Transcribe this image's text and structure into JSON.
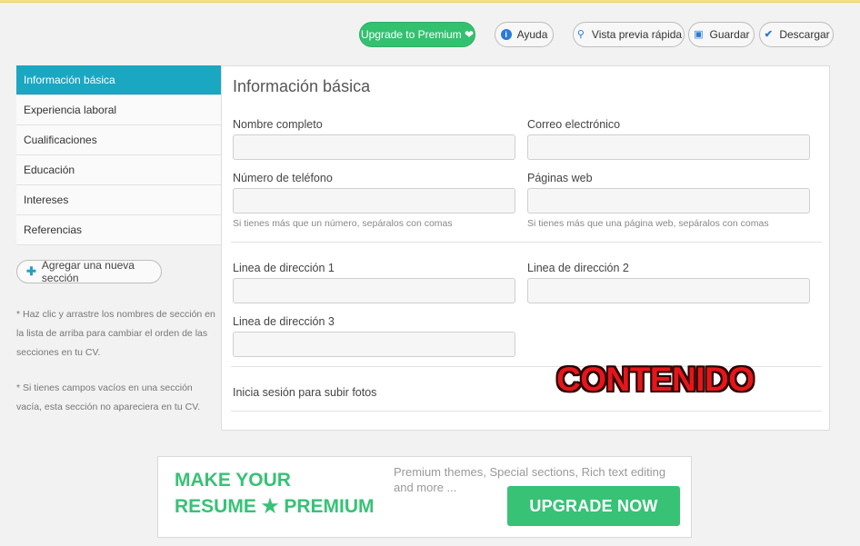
{
  "toolbar": {
    "premium_label": "Upgrade to Premium ❤",
    "help_label": "Ayuda",
    "preview_label": "Vista previa rápida",
    "save_label": "Guardar",
    "download_label": "Descargar"
  },
  "sidebar": {
    "items": [
      {
        "label": "Información básica"
      },
      {
        "label": "Experiencia laboral"
      },
      {
        "label": "Cualificaciones"
      },
      {
        "label": "Educación"
      },
      {
        "label": "Intereses"
      },
      {
        "label": "Referencias"
      }
    ],
    "add_section_label": "Agregar una nueva sección",
    "hint1": "* Haz clic y arrastre los nombres de sección en la lista de arriba para cambiar el orden de las secciones en tu CV.",
    "hint2": "* Si tienes campos vacíos en una sección vacía, esta sección no apareciera en tu CV."
  },
  "form": {
    "title": "Información básica",
    "full_name_label": "Nombre completo",
    "email_label": "Correo electrónico",
    "phone_label": "Número de teléfono",
    "phone_help": "Si tienes más que un número, sepáralos con comas",
    "web_label": "Páginas web",
    "web_help": "Si tienes más que una página web, sepáralos con comas",
    "address1_label": "Linea de dirección 1",
    "address2_label": "Linea de dirección 2",
    "address3_label": "Linea de dirección 3",
    "photo_label": "Inicia sesión para subir fotos"
  },
  "overlay_text": "CONTENIDO",
  "banner": {
    "line1": "MAKE YOUR",
    "line2": "RESUME ★ PREMIUM",
    "desc": "Premium themes, Special sections, Rich text editing and more ...",
    "button": "UPGRADE NOW"
  },
  "colors": {
    "accent": "#1aa7c1",
    "premium_green": "#33c16f",
    "overlay_red": "#e5161b"
  }
}
